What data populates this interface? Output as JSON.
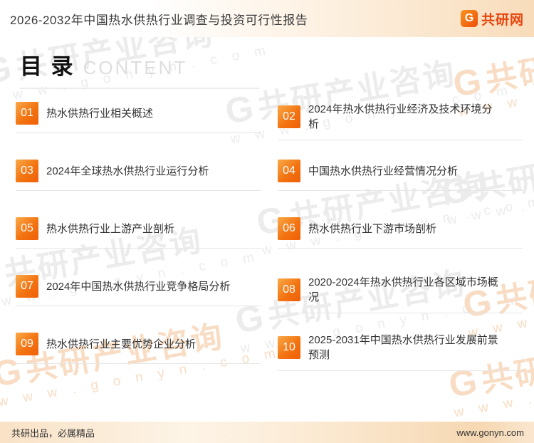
{
  "header": {
    "title": "2026-2032年中国热水供热行业调查与投资可行性报告",
    "logo": {
      "glyph": "G",
      "text": "共研网"
    }
  },
  "toc": {
    "heading": "目 录",
    "heading_en": "CONTENT",
    "items": [
      {
        "num": "01",
        "title": "热水供热行业相关概述"
      },
      {
        "num": "02",
        "title": "2024年热水供热行业经济及技术环境分析"
      },
      {
        "num": "03",
        "title": "2024年全球热水供热行业运行分析"
      },
      {
        "num": "04",
        "title": "中国热水供热行业经营情况分析"
      },
      {
        "num": "05",
        "title": "热水供热行业上游产业剖析"
      },
      {
        "num": "06",
        "title": "热水供热行业下游市场剖析"
      },
      {
        "num": "07",
        "title": "2024年中国热水供热行业竞争格局分析"
      },
      {
        "num": "08",
        "title": "2020-2024年热水供热行业各区域市场概况"
      },
      {
        "num": "09",
        "title": "热水供热行业主要优势企业分析"
      },
      {
        "num": "10",
        "title": "2025-2031年中国热水供热行业发展前景预测"
      }
    ]
  },
  "watermark": {
    "glyph": "G",
    "brand": "共研产业咨询",
    "url": "w w w . g o n y n . c o m"
  },
  "footer": {
    "left": "共研出品，必属精品",
    "right": "www.gonyn.com"
  },
  "colors": {
    "accent_orange": "#f26c0d",
    "badge_gradient_start": "#f9a948",
    "badge_gradient_end": "#ef5f07",
    "logo_red": "#e8440c",
    "header_peach": "#f8dcba",
    "watermark_gray": "#ececec",
    "watermark_peach": "#f8ddc4"
  }
}
